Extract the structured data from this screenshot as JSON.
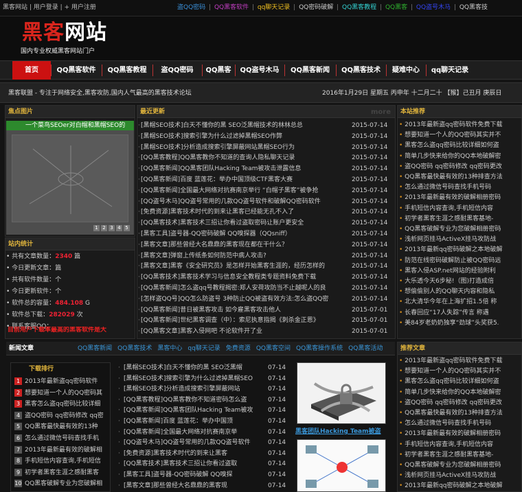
{
  "topbar": {
    "left_text": "黑客网站 | 用户登录 | + 用户注册",
    "links": [
      {
        "label": "盗QQ密码",
        "color": "#3a8fd8"
      },
      {
        "label": "QQ黑客软件",
        "color": "#c23ec2"
      },
      {
        "label": "qq聊天记录",
        "color": "#f0c020"
      },
      {
        "label": "QQ密码破解",
        "color": "#cccccc"
      },
      {
        "label": "QQ黑客教程",
        "color": "#33d0d0"
      },
      {
        "label": "QQ黑客",
        "color": "#2fb02f"
      },
      {
        "label": "QQ盗号木马",
        "color": "#3344ee"
      },
      {
        "label": "QQ黑客技",
        "color": "#cccccc"
      }
    ]
  },
  "logo": {
    "title_red": "黑客",
    "title_white": "网站",
    "subtitle": "国内专业权威黑客网站门户"
  },
  "nav": {
    "items": [
      "首页",
      "QQ黑客软件",
      "QQ黑客教程",
      "盗QQ密码",
      "QQ黑客",
      "QQ盗号木马",
      "QQ黑客新闻",
      "QQ黑客技术",
      "疑难中心",
      "qq聊天记录"
    ]
  },
  "infobar": {
    "left": "黑客联盟 - 专注于网络安全,黑客攻防,国内人气最高的黑客技术论坛",
    "right": "2016年1月29日 星期五  丙申年 十二月二十 【猴】己丑月 庚辰日"
  },
  "focus": {
    "title": "焦点图片",
    "caption": "一个菜鸟SEOer对白帽和黑帽SEO的",
    "dots": [
      "1",
      "2",
      "3",
      "4",
      "5"
    ]
  },
  "stats": {
    "title": "站内统计",
    "lines": [
      {
        "label": "共有文章数量：",
        "value": "2340",
        "unit": " 篇"
      },
      {
        "label": "今日更新文章：",
        "value": "",
        "unit": "篇"
      },
      {
        "label": "共有软件数量：",
        "value": "",
        "unit": "个"
      },
      {
        "label": "今日更新软件：",
        "value": "",
        "unit": "个"
      },
      {
        "label": "软件总的容量：",
        "value": "484.108",
        "unit": " G"
      },
      {
        "label": "软件总下载：",
        "value": "282029",
        "unit": " 次"
      },
      {
        "label": "联系客服QQ：",
        "value": "",
        "unit": ""
      }
    ],
    "ticker": "目前用户下载率最高的黑客软件是大"
  },
  "latest": {
    "title": "最近更新",
    "more": "more",
    "items": [
      {
        "t": "[黑帽SEO技术]白天不懂你的黑 SEO泛黑帽技术的林林总总",
        "d": "2015-07-14"
      },
      {
        "t": "[黑帽SEO技术]搜索引擎为什么过滤掉黑帽SEO作弊",
        "d": "2015-07-14"
      },
      {
        "t": "[黑帽SEO技术]分析造成搜索引擎屏蔽网站黑帽SEO行为",
        "d": "2015-07-14"
      },
      {
        "t": "[QQ黑客教程]QQ黑客教你不知道的查询人隐私聊天记录",
        "d": "2015-07-14"
      },
      {
        "t": "[QQ黑客新闻]QQ黑客团队Hacking Team被攻击泄露信息",
        "d": "2015-07-14"
      },
      {
        "t": "[QQ黑客新闻]百度 蓝莲花：举办中国顶级CTF黑客大赛",
        "d": "2015-07-14"
      },
      {
        "t": "[QQ黑客新闻]全国最大网络对抗赛南京举行 “白帽子黑客”被争抢",
        "d": "2015-07-14"
      },
      {
        "t": "[QQ盗号木马]QQ盗号常用的几款QQ盗号软件和破解QQ密码软件",
        "d": "2015-07-14"
      },
      {
        "t": "[免费资源]黑客技术时代的到来让黑客已经能无孔不入了",
        "d": "2015-07-14"
      },
      {
        "t": "[QQ黑客技术]黑客技术三招让你看过盗取密码让账户更安全",
        "d": "2015-07-14"
      },
      {
        "t": "[黑客工具]盗号器-QQ密码破解 QQ嗅探器（QQsniff）",
        "d": "2015-07-14"
      },
      {
        "t": "[黑客文章]那些曾经大名鼎鼎的黑客现在都在干什么？",
        "d": "2015-07-14"
      },
      {
        "t": "[黑客文章]弹窗上传纸条如何防范中病人攻击?",
        "d": "2015-07-14"
      },
      {
        "t": "[黑客文章]黑客《安全研究员》是怎样开始黑客生涯的，经历怎样的",
        "d": "2015-07-14"
      },
      {
        "t": "[QQ黑客技术]黑客技术学习与信息安全教程类专题资料免费下载",
        "d": "2015-07-14"
      },
      {
        "t": "[QQ黑客新闻]怎么盗qq号教程揭密:郑人安荷攻防当不止越呢人的良",
        "d": "2015-07-14"
      },
      {
        "t": "[怎样盗QQ号]QQ怎么防盗号 3种防止QQ被盗有效方法:怎么盗QQ密",
        "d": "2015-07-14"
      },
      {
        "t": "[QQ黑客新闻]昔日被黑客攻击 如今雇黑客攻击他人",
        "d": "2015-07-01"
      },
      {
        "t": "[QQ黑客新闻]世纪黑客调查（中）：索尼执意指揭《刺杀金正恩》",
        "d": "2015-07-01"
      },
      {
        "t": "[QQ黑客文章]黑客入侵网吧 不论软件开了业",
        "d": "2015-07-01"
      }
    ]
  },
  "recommend": {
    "title": "本站推荐",
    "items": [
      "2013年最新盗qq密码软件免费下载",
      "想要知道一个人的QQ密码其实并不",
      "黑客怎么盗qq密码比较详细如何盗",
      "简单几步快来给你的QQ本地破解密",
      "盗QQ密码 qq密码修改 qq密码更改",
      "QQ黑客最快最有效的13种排查方法",
      "怎么通过微信号码查找手机号码",
      "2013年最新最有效的破解相册密码",
      "手机短信内容查询,手机短信内容",
      "初学者黑客生涯之感耐黑客基地-",
      "QQ黑客破解专业为您破解相册密码",
      "浅析网页挂马ActiveX挂马攻防战",
      "2013年最新qq密码破解之本地破解",
      "防范在线密码破解防止被QQ密码远",
      "黑客入侵ASP.net网站的经验附利",
      "大乐透今天6步秘!（图)打造成倍",
      "想偷偷别人的QQ聊天内容和隐私",
      "北大清华今年在上海扩招1.5倍 称",
      "长春回应“17人失踪”传言 称遇",
      "美84岁老奶奶独享“劲球”头奖获5."
    ]
  },
  "section2": {
    "title": "新闻文章",
    "tabs": [
      "QQ黑客新闻",
      "QQ黑客技术",
      "黑客中心",
      "qq聊天记录",
      "免费资源",
      "QQ黑客空间",
      "QQ黑客操作系统",
      "QQ黑客活动"
    ],
    "rank_title": "下载排行",
    "rank": [
      "2013年最新盗qq密码软件",
      "想要知道一个人的QQ密码其",
      "黑客怎么盗qq密码比较详细",
      "盗QQ密码 qq密码修改 qq密",
      "QQ黑客最快最有效的13种",
      "怎么通过微信号码查找手机",
      "2013年最新最有效的破解相",
      "手机短信内容查询,手机短信",
      "初学者黑客生涯之感耐黑客",
      "QQ黑客破解专业为您破解相"
    ],
    "list": [
      {
        "t": "[黑帽SEO技术]白天不懂你的黑 SEO泛黑帽",
        "d": "07-14"
      },
      {
        "t": "[黑帽SEO技术]搜索引擎为什么过滤掉黑帽SEO",
        "d": "07-14"
      },
      {
        "t": "[黑帽SEO技术]分析造成搜索引擎屏蔽网站",
        "d": "07-14"
      },
      {
        "t": "[QQ黑客教程]QQ黑客教你不知道密码怎么盗",
        "d": "07-14"
      },
      {
        "t": "[QQ黑客新闻]QQ黑客团队Hacking Team被攻",
        "d": "07-14"
      },
      {
        "t": "[QQ黑客新闻]百度 蓝莲花：举办中国顶",
        "d": "07-14"
      },
      {
        "t": "[QQ黑客新闻]全国最大网络对抗赛南京举",
        "d": "07-14"
      },
      {
        "t": "[QQ盗号木马]QQ盗号常用的几款QQ盗号软件",
        "d": "07-14"
      },
      {
        "t": "[免费资源]黑客技术时代的到来让黑客",
        "d": "07-14"
      },
      {
        "t": "[QQ黑客技术]黑客技术三招让你看过盗取",
        "d": "07-14"
      },
      {
        "t": "[黑客工具]盗号器-QQ密码破解 QQ嗅探",
        "d": "07-14"
      },
      {
        "t": "[黑客文章]那些曾经大名鼎鼎的黑客现",
        "d": "07-14"
      }
    ],
    "thumb_caption": "黑客团队Hacking Team被盗",
    "right_title": "推荐文章",
    "right_items": [
      "2013年最新盗qq密码软件免费下载",
      "想要知道一个人的QQ密码其实并不",
      "黑客怎么盗qq密码比较详细如何盗",
      "简单几步快来给你的QQ本地破解密",
      "盗QQ密码 qq密码修改 qq密码更改",
      "QQ黑客最快最有效的13种排查方法",
      "怎么通过微信号码查找手机号码",
      "2013年最新最有效的破解相册密码",
      "手机短信内容查询,手机短信内容",
      "初学者黑客生涯之感耐黑客基地-",
      "QQ黑客破解专业为您破解相册密码",
      "浅析网页挂马ActiveX挂马攻防战",
      "2013年最新qq密码破解之本地破解"
    ]
  },
  "colors": {
    "brand_red": "#d9251d",
    "accent_gold": "#e0b43c",
    "link_blue": "#3a96d8",
    "bg": "#141414"
  }
}
